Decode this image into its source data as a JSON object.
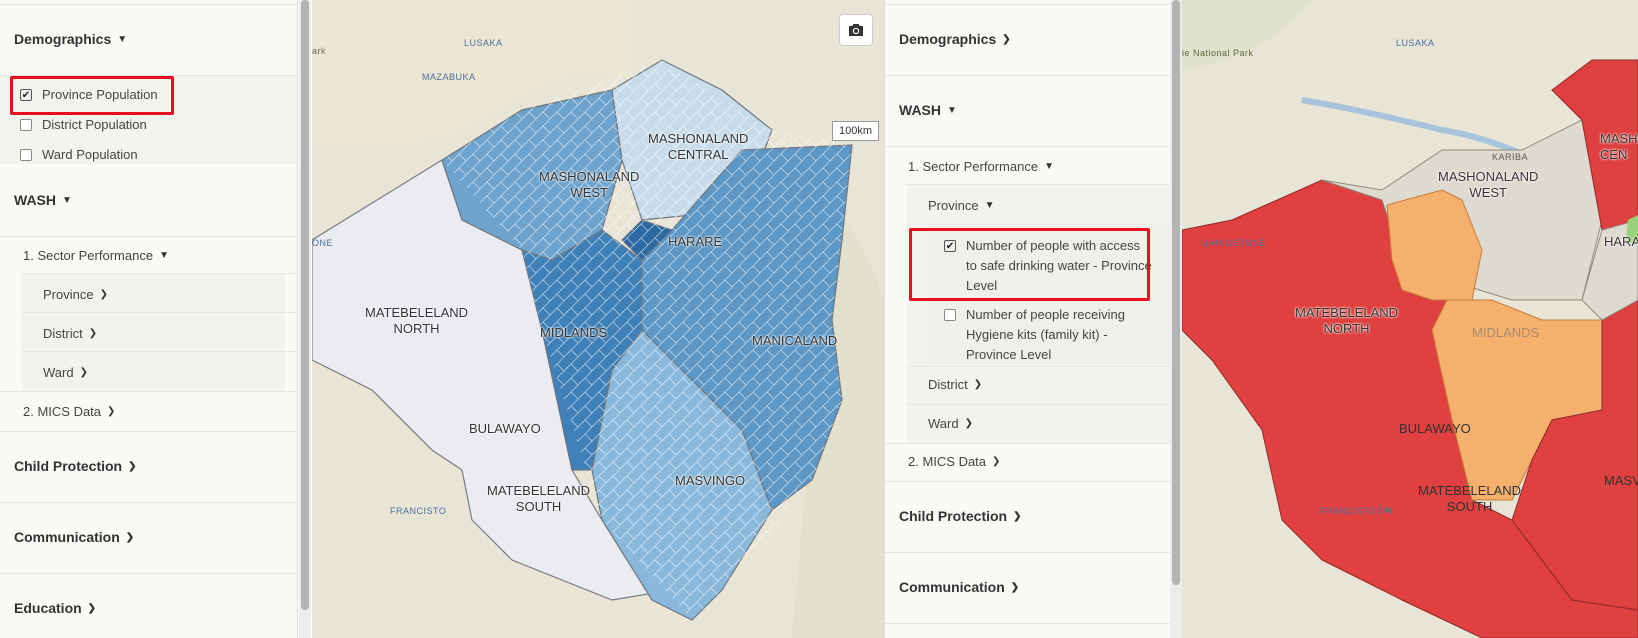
{
  "left_panel": {
    "demographics": "Demographics",
    "layers": [
      {
        "label": "Province Population",
        "checked": true
      },
      {
        "label": "District Population",
        "checked": false
      },
      {
        "label": "Ward Population",
        "checked": false
      }
    ],
    "wash": "WASH",
    "sector_performance": "1. Sector Performance",
    "province": "Province",
    "district": "District",
    "ward": "Ward",
    "mics": "2. MICS Data",
    "child_protection": "Child Protection",
    "communication": "Communication",
    "education": "Education"
  },
  "left_map": {
    "labels": {
      "mashonaland_central": "MASHONALAND\nCENTRAL",
      "mashonaland_west": "MASHONALAND\nWEST",
      "harare": "HARARE",
      "matebeleland_north": "MATEBELELAND\nNORTH",
      "midlands": "MIDLANDS",
      "manicaland": "MANICALAND",
      "bulawayo": "BULAWAYO",
      "masvingo": "MASVINGO",
      "matebeleland_south": "MATEBELELAND\nSOUTH"
    },
    "cities": {
      "lusaka": "LUSAKA",
      "mazabuka": "MAZABUKA",
      "francistown": "FRANCISTO",
      "livingstone": "ONE",
      "park": "ark"
    },
    "scale": "100km"
  },
  "right_panel": {
    "demographics": "Demographics",
    "wash": "WASH",
    "sector_performance": "1. Sector Performance",
    "province": "Province",
    "indicators": [
      {
        "label": "Number of people with access to safe drinking water - Province Level",
        "checked": true
      },
      {
        "label": "Number of people receiving Hygiene kits (family kit) - Province Level",
        "checked": false
      }
    ],
    "district": "District",
    "ward": "Ward",
    "mics": "2. MICS Data",
    "child_protection": "Child Protection",
    "communication": "Communication"
  },
  "right_map": {
    "labels": {
      "mashonaland_west": "MASHONALAND\nWEST",
      "mashonaland_cen": "MASHO\nCEN",
      "harare": "HARA",
      "matebeleland_north": "MATEBELELAND\nNORTH",
      "midlands": "MIDLANDS",
      "bulawayo": "BULAWAYO",
      "matebeleland_south": "MATEBELELAND\nSOUTH",
      "masvingo": "MASV"
    },
    "cities": {
      "lusaka": "LUSAKA",
      "park": "ie National Park",
      "livingstone": "LIVINGSTONE",
      "francistown": "FRANCISTOWN",
      "kariba": "KARIBA"
    }
  },
  "colors": {
    "red": "#e8101a",
    "choropleth_dark": "#4f8cc0",
    "choropleth_light": "#c6dced",
    "map_red": "#e0403f",
    "map_orange": "#f6b06e"
  }
}
